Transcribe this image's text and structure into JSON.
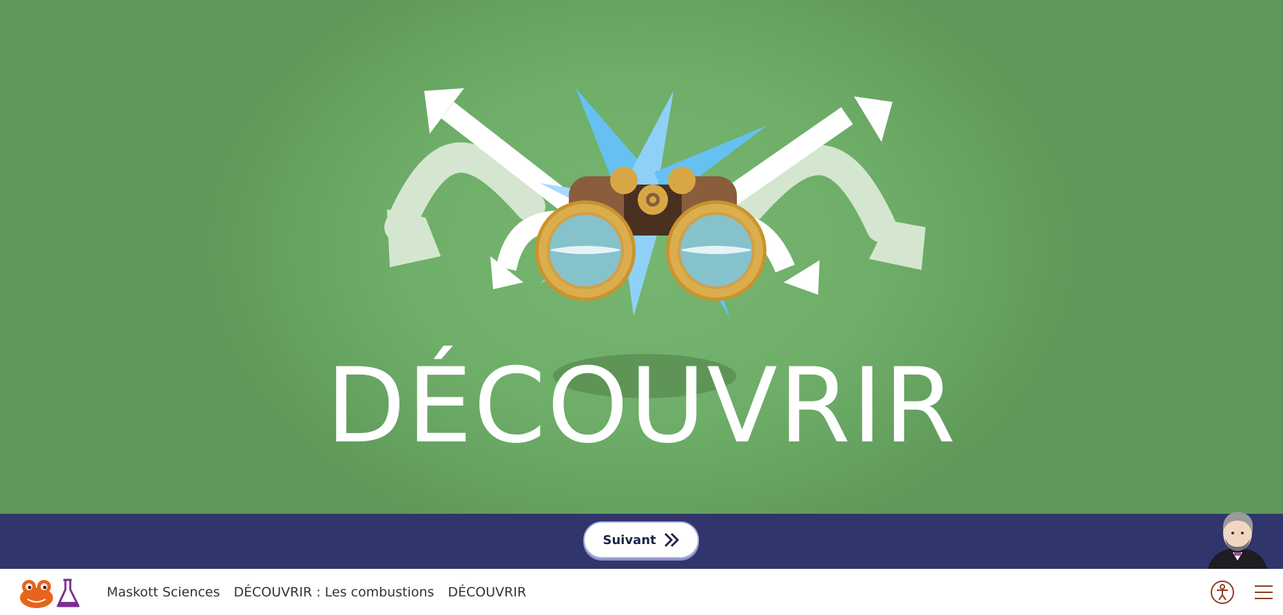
{
  "hero": {
    "title": "DÉCOUVRIR",
    "illustration_icon": "binoculars-compass-icon",
    "background_color": "#6eae69"
  },
  "action_bar": {
    "next_label": "Suivant",
    "next_icon": "double-chevron-right-icon",
    "avatar_icon": "scientist-avatar-icon",
    "background_color": "#30366b"
  },
  "footer": {
    "logo_icon": "maskott-frog-flask-logo-icon",
    "breadcrumb": [
      "Maskott Sciences",
      "DÉCOUVRIR : Les combustions",
      "DÉCOUVRIR"
    ],
    "accessibility_icon": "accessibility-icon",
    "menu_icon": "hamburger-menu-icon",
    "accent_color": "#8b3d1e"
  }
}
